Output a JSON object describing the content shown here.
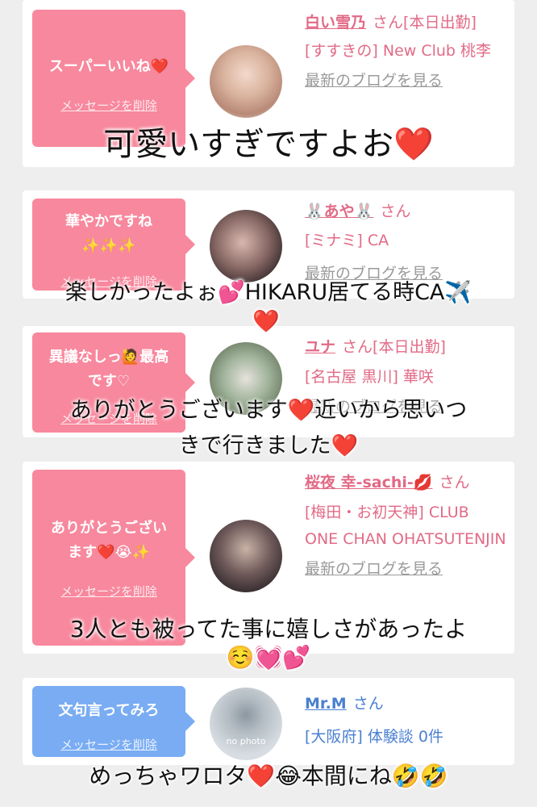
{
  "delete_label": "メッセージを削除",
  "san": "さん",
  "cards": [
    {
      "bubble": "スーパーいいね❤️",
      "name": "白い雪乃",
      "status": "[本日出勤]",
      "area": "[すすきの] New Club 桃李",
      "blog": "最新のブログを見る"
    },
    {
      "bubble": "華やかですね ✨✨✨",
      "name": "🐰あや🐰",
      "status": "",
      "area": "[ミナミ] CA",
      "blog": "最新のブログを見る"
    },
    {
      "bubble": "異議なしっ🙋最高です♡",
      "name": "ユナ",
      "status": "[本日出勤]",
      "area": "[名古屋 黒川] 華咲",
      "blog": "最新のブログを見る"
    },
    {
      "bubble": "ありがとうございます❤️😭✨",
      "name": "桜夜 幸-sachi-💋",
      "status": "",
      "area": "[梅田・お初天神] CLUB ONE CHAN OHATSUTENJIN",
      "blog": "最新のブログを見る"
    },
    {
      "bubble": "文句言ってみろ",
      "name": "Mr.M",
      "status": "",
      "area": "[大阪府] 体験談 0件",
      "avatar_text": "no photo"
    }
  ],
  "captions": {
    "c1": "可愛いすぎですよお❤️",
    "c2a": "楽しかったよぉ💕HIKARU居てる時CA✈️",
    "c2b": "❤️",
    "c3a": "ありがとうございます❤️近いから思いつ",
    "c3b": "きで行きました❤️",
    "c4a": "3人とも被ってた事に嬉しさがあったよ",
    "c4b": "☺️💓💕",
    "c5": "めっちゃワロタ❤️😂本間にね🤣🤣"
  }
}
